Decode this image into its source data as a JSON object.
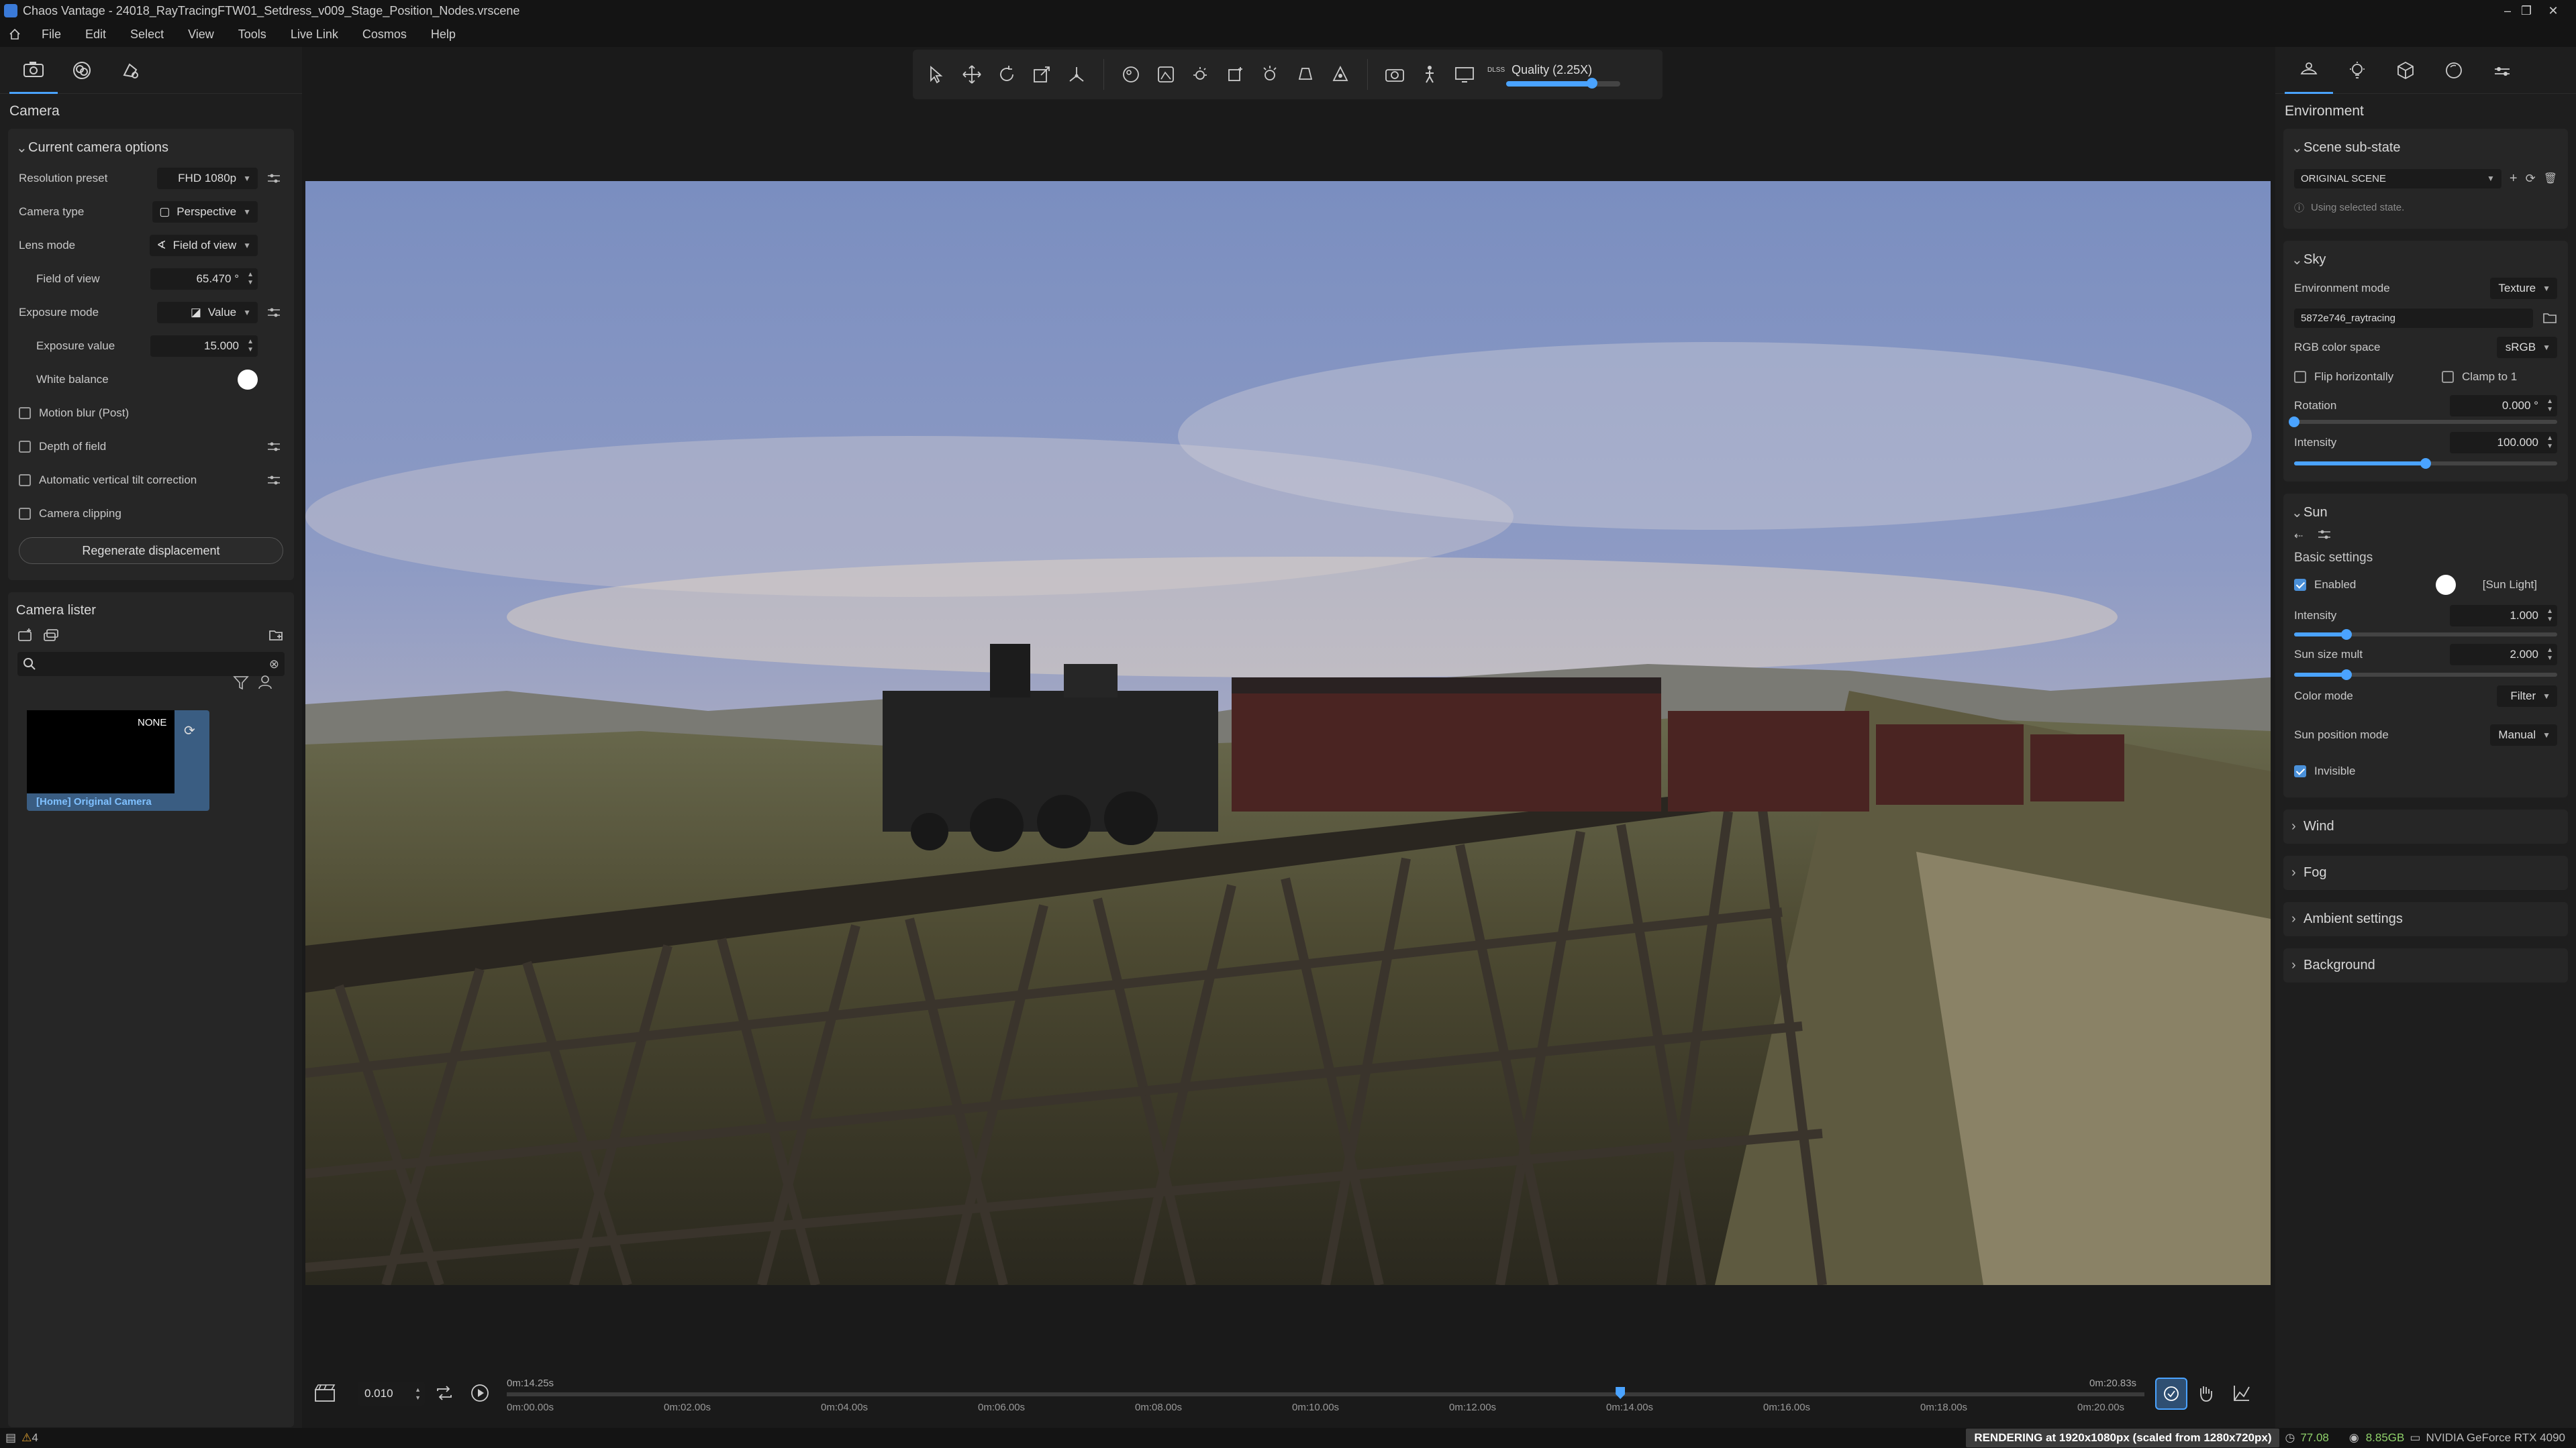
{
  "window": {
    "title": "Chaos Vantage - 24018_RayTracingFTW01_Setdress_v009_Stage_Position_Nodes.vrscene",
    "controls": [
      "–",
      "❐",
      "✕"
    ]
  },
  "menu": [
    "File",
    "Edit",
    "Select",
    "View",
    "Tools",
    "Live Link",
    "Cosmos",
    "Help"
  ],
  "toolbar": {
    "quality_label": "Quality (2.25X)",
    "dlss_label": "DLSS",
    "quality_fraction": 0.75
  },
  "left": {
    "panel_title": "Camera",
    "section_title": "Current camera options",
    "resolution_label": "Resolution preset",
    "resolution_value": "FHD 1080p",
    "camera_type_label": "Camera type",
    "camera_type_value": "Perspective",
    "lens_mode_label": "Lens mode",
    "lens_mode_value": "Field of view",
    "fov_label": "Field of view",
    "fov_value": "65.470 °",
    "exposure_mode_label": "Exposure mode",
    "exposure_mode_value": "Value",
    "exposure_value_label": "Exposure value",
    "exposure_value": "15.000",
    "white_balance_label": "White balance",
    "motion_blur_label": "Motion blur (Post)",
    "dof_label": "Depth of field",
    "tilt_label": "Automatic vertical tilt correction",
    "clipping_label": "Camera clipping",
    "regen_button": "Regenerate displacement",
    "lister_title": "Camera lister",
    "thumb_badge": "NONE",
    "thumb_label": "[Home] Original Camera"
  },
  "right": {
    "panel_title": "Environment",
    "scene_substate_title": "Scene sub-state",
    "scene_value": "ORIGINAL SCENE",
    "using_selected": "Using selected state.",
    "sky_title": "Sky",
    "env_mode_label": "Environment mode",
    "env_mode_value": "Texture",
    "texture_name": "5872e746_raytracing",
    "rgb_label": "RGB color space",
    "rgb_value": "sRGB",
    "flip_label": "Flip horizontally",
    "clamp_label": "Clamp to 1",
    "rotation_label": "Rotation",
    "rotation_value": "0.000 °",
    "rotation_fraction": 0.0,
    "intensity_label": "Intensity",
    "intensity_value": "100.000",
    "intensity_fraction": 0.5,
    "sun_title": "Sun",
    "basic_settings": "Basic settings",
    "enabled_label": "Enabled",
    "sun_light_label": "[Sun Light]",
    "sun_intensity_label": "Intensity",
    "sun_intensity_value": "1.000",
    "sun_intensity_fraction": 0.2,
    "sun_size_label": "Sun size mult",
    "sun_size_value": "2.000",
    "sun_size_fraction": 0.2,
    "color_mode_label": "Color mode",
    "color_mode_value": "Filter",
    "sun_pos_label": "Sun position mode",
    "sun_pos_value": "Manual",
    "invisible_label": "Invisible",
    "wind_title": "Wind",
    "fog_title": "Fog",
    "ambient_title": "Ambient settings",
    "background_title": "Background"
  },
  "timeline": {
    "frame_value": "0.010",
    "start_label": "0m:14.25s",
    "end_label": "0m:20.83s",
    "ticks": [
      "0m:00.00s",
      "0m:02.00s",
      "0m:04.00s",
      "0m:06.00s",
      "0m:08.00s",
      "0m:10.00s",
      "0m:12.00s",
      "0m:14.00s",
      "0m:16.00s",
      "0m:18.00s",
      "0m:20.00s"
    ],
    "playhead_fraction": 0.68
  },
  "status": {
    "warning_count": "4",
    "rendering": "RENDERING at 1920x1080px (scaled from 1280x720px)",
    "fps": "77.08",
    "vram": "8.85GB",
    "gpu": "NVIDIA GeForce RTX 4090"
  }
}
